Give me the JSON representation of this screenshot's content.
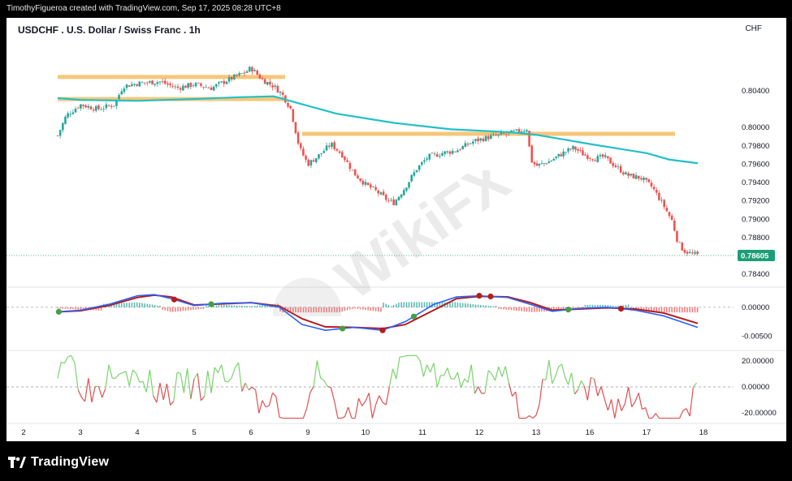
{
  "header": {
    "attribution": "TimothyFigueroa created with TradingView.com, Sep 17, 2025 08:28 UTC+8"
  },
  "chart_title": "USDCHF . U.S. Dollar / Swiss Franc . 1h",
  "currency": "CHF",
  "footer": {
    "brand": "TradingView"
  },
  "watermark_text": "WikiFX",
  "colors": {
    "background": "#ffffff",
    "up_candle": "#26a69a",
    "down_candle": "#ef5350",
    "moving_average": "#22bfc8",
    "support_resistance": "#f5c16c",
    "macd_line": "#2962ff",
    "signal_line": "#43a047",
    "macd_cross_down": "#b71c1c",
    "rsi_up": "#7bd36d",
    "rsi_down": "#e05050",
    "last_price_badge": "#1b9e77"
  },
  "chart_data": {
    "type": "candlestick",
    "instrument": "USDCHF",
    "timeframe": "1h",
    "x_ticks": [
      "2",
      "3",
      "4",
      "5",
      "6",
      "9",
      "10",
      "11",
      "12",
      "13",
      "16",
      "17",
      "18"
    ],
    "price_axis": {
      "ylim": [
        0.7826,
        0.81
      ],
      "ticks": [
        "0.80400",
        "0.80000",
        "0.79800",
        "0.79600",
        "0.79400",
        "0.79200",
        "0.79000",
        "0.78800",
        "0.78400"
      ],
      "last_price": "0.78605"
    },
    "horizontal_levels": [
      {
        "price": 0.8055,
        "from_day": 1.6,
        "to_day": 5.6
      },
      {
        "price": 0.8031,
        "from_day": 1.6,
        "to_day": 5.6
      },
      {
        "price": 0.7993,
        "from_day": 5.9,
        "to_day": 12.5
      }
    ],
    "close_path": [
      [
        1.6,
        0.7991
      ],
      [
        1.75,
        0.8013
      ],
      [
        2.0,
        0.8025
      ],
      [
        2.3,
        0.802
      ],
      [
        2.6,
        0.8025
      ],
      [
        2.75,
        0.8045
      ],
      [
        3.0,
        0.8048
      ],
      [
        3.4,
        0.805
      ],
      [
        3.7,
        0.8043
      ],
      [
        4.0,
        0.8047
      ],
      [
        4.3,
        0.8043
      ],
      [
        4.6,
        0.8052
      ],
      [
        4.9,
        0.806
      ],
      [
        5.0,
        0.8065
      ],
      [
        5.2,
        0.8052
      ],
      [
        5.4,
        0.8045
      ],
      [
        5.55,
        0.8036
      ],
      [
        5.7,
        0.802
      ],
      [
        5.85,
        0.7978
      ],
      [
        6.0,
        0.796
      ],
      [
        6.2,
        0.797
      ],
      [
        6.4,
        0.7982
      ],
      [
        6.6,
        0.797
      ],
      [
        6.8,
        0.795
      ],
      [
        7.0,
        0.7938
      ],
      [
        7.2,
        0.793
      ],
      [
        7.4,
        0.792
      ],
      [
        7.5,
        0.7918
      ],
      [
        7.7,
        0.7935
      ],
      [
        7.9,
        0.7955
      ],
      [
        8.1,
        0.7968
      ],
      [
        8.35,
        0.7972
      ],
      [
        8.6,
        0.7975
      ],
      [
        8.9,
        0.7985
      ],
      [
        9.2,
        0.799
      ],
      [
        9.5,
        0.7993
      ],
      [
        9.7,
        0.7996
      ],
      [
        9.85,
        0.7999
      ],
      [
        9.9,
        0.7965
      ],
      [
        10.0,
        0.7958
      ],
      [
        10.25,
        0.7963
      ],
      [
        10.5,
        0.7972
      ],
      [
        10.7,
        0.7978
      ],
      [
        10.9,
        0.797
      ],
      [
        11.1,
        0.7966
      ],
      [
        11.25,
        0.7968
      ],
      [
        11.45,
        0.7958
      ],
      [
        11.65,
        0.7948
      ],
      [
        11.9,
        0.7945
      ],
      [
        12.1,
        0.7935
      ],
      [
        12.3,
        0.7915
      ],
      [
        12.45,
        0.7898
      ],
      [
        12.55,
        0.7875
      ],
      [
        12.65,
        0.7866
      ],
      [
        12.8,
        0.7862
      ],
      [
        12.9,
        0.7861
      ]
    ],
    "moving_average": [
      [
        1.6,
        0.8032
      ],
      [
        2.0,
        0.803
      ],
      [
        3.0,
        0.8029
      ],
      [
        4.0,
        0.8031
      ],
      [
        4.8,
        0.8033
      ],
      [
        5.4,
        0.8034
      ],
      [
        5.8,
        0.8027
      ],
      [
        6.5,
        0.8015
      ],
      [
        7.5,
        0.8005
      ],
      [
        8.5,
        0.7998
      ],
      [
        9.5,
        0.7995
      ],
      [
        10.0,
        0.7992
      ],
      [
        10.5,
        0.7987
      ],
      [
        11.0,
        0.7982
      ],
      [
        11.5,
        0.7977
      ],
      [
        12.0,
        0.7972
      ],
      [
        12.4,
        0.7965
      ],
      [
        12.9,
        0.7961
      ]
    ],
    "macd": {
      "yticks": [
        "0.00000",
        "-0.00500"
      ],
      "ylim": [
        -0.0075,
        0.0035
      ],
      "macd_line": [
        [
          1.6,
          -0.0008
        ],
        [
          2.0,
          -0.0005
        ],
        [
          2.5,
          0.0005
        ],
        [
          3.0,
          0.002
        ],
        [
          3.3,
          0.0022
        ],
        [
          3.6,
          0.0015
        ],
        [
          4.0,
          0.0003
        ],
        [
          4.5,
          0.0007
        ],
        [
          5.0,
          0.0008
        ],
        [
          5.5,
          0.0
        ],
        [
          5.9,
          -0.003
        ],
        [
          6.3,
          -0.004
        ],
        [
          6.8,
          -0.0035
        ],
        [
          7.3,
          -0.004
        ],
        [
          7.7,
          -0.0025
        ],
        [
          8.2,
          0.0005
        ],
        [
          8.6,
          0.0018
        ],
        [
          9.0,
          0.002
        ],
        [
          9.5,
          0.0017
        ],
        [
          9.9,
          0.0005
        ],
        [
          10.3,
          -0.0007
        ],
        [
          10.8,
          -0.0002
        ],
        [
          11.3,
          0.0
        ],
        [
          11.8,
          -0.0005
        ],
        [
          12.3,
          -0.0015
        ],
        [
          12.9,
          -0.0035
        ]
      ],
      "signal_line": [
        [
          1.6,
          -0.0008
        ],
        [
          2.0,
          -0.0006
        ],
        [
          2.5,
          0.0003
        ],
        [
          3.0,
          0.0017
        ],
        [
          3.3,
          0.0021
        ],
        [
          3.6,
          0.0018
        ],
        [
          4.0,
          0.0004
        ],
        [
          4.5,
          0.0006
        ],
        [
          5.0,
          0.0008
        ],
        [
          5.5,
          0.0002
        ],
        [
          5.9,
          -0.002
        ],
        [
          6.3,
          -0.0034
        ],
        [
          6.8,
          -0.0035
        ],
        [
          7.3,
          -0.0037
        ],
        [
          7.7,
          -0.003
        ],
        [
          8.2,
          -0.0005
        ],
        [
          8.6,
          0.0015
        ],
        [
          9.0,
          0.0019
        ],
        [
          9.5,
          0.0018
        ],
        [
          9.9,
          0.0008
        ],
        [
          10.3,
          -0.0005
        ],
        [
          10.8,
          -0.0003
        ],
        [
          11.3,
          -0.0001
        ],
        [
          11.8,
          -0.0003
        ],
        [
          12.3,
          -0.001
        ],
        [
          12.9,
          -0.0028
        ]
      ],
      "histogram_sign": [
        [
          1.6,
          -1
        ],
        [
          2.4,
          1
        ],
        [
          3.4,
          -1
        ],
        [
          4.2,
          1
        ],
        [
          5.5,
          -1
        ],
        [
          7.3,
          1
        ],
        [
          9.3,
          -1
        ],
        [
          10.9,
          1
        ],
        [
          11.7,
          -1
        ]
      ]
    },
    "rsi_panel": {
      "yticks": [
        "20.00000",
        "0.00000",
        "-20.00000"
      ],
      "ylim": [
        -28,
        28
      ]
    }
  }
}
